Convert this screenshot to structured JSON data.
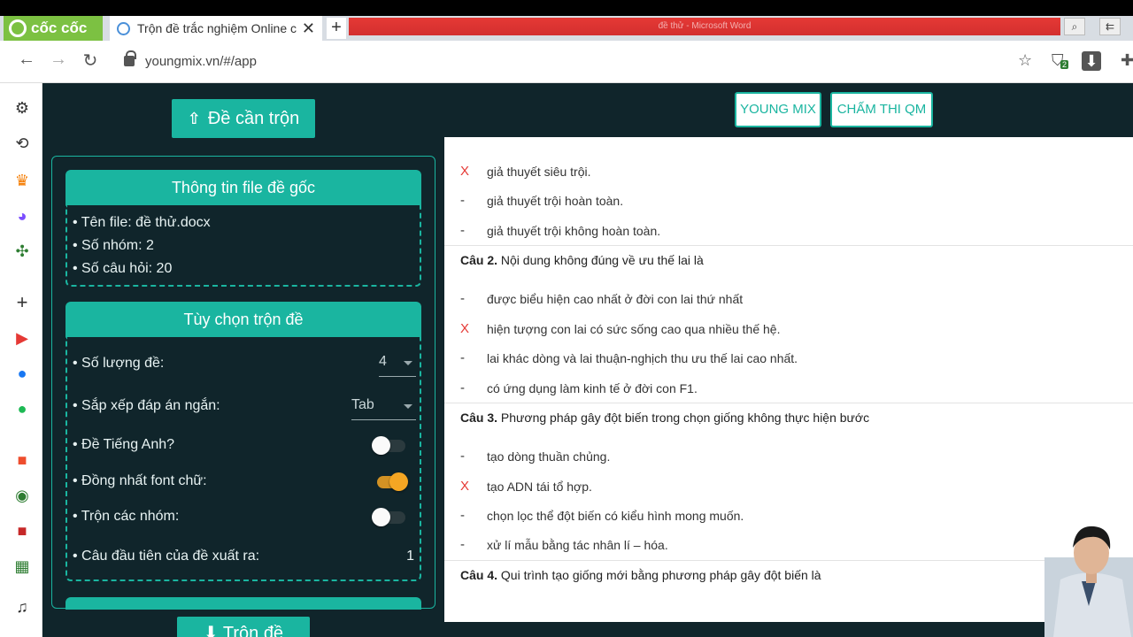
{
  "browser": {
    "brand": "cốc cốc",
    "tab_title": "Trộn đề trắc nghiệm Online c",
    "tab_close": "✕",
    "new_tab": "+",
    "red_strip_text": "đề thử - Microsoft Word",
    "url": "youngmix.vn/#/app",
    "extension_badge": "2"
  },
  "app": {
    "upload_button": "Đề cần trộn",
    "file_info": {
      "title": "Thông tin file đề gốc",
      "lines": [
        "• Tên file: đề thử.docx",
        "• Số nhóm: 2",
        "• Số câu hỏi: 20"
      ]
    },
    "options": {
      "title": "Tùy chọn trộn đề",
      "count_label": "• Số lượng đề:",
      "count_value": "4",
      "sort_label": "• Sắp xếp đáp án ngắn:",
      "sort_value": "Tab",
      "english_label": "• Đề Tiếng Anh?",
      "english_on": false,
      "font_label": "• Đồng nhất font chữ:",
      "font_on": true,
      "groups_label": "• Trộn các nhóm:",
      "groups_on": false,
      "first_q_label": "• Câu đầu tiên của đề xuất ra:",
      "first_q_value": "1"
    },
    "mix_button": "Trộn đề",
    "top_buttons": [
      "YOUNG MIX",
      "CHẤM THI QM"
    ],
    "colors": {
      "teal": "#1ab5a0",
      "bg": "#10252b",
      "orange": "#f5a623",
      "mark_red": "#e53935"
    }
  },
  "document": {
    "q1_answers": [
      {
        "mark": "X",
        "text": "giả thuyết siêu trội."
      },
      {
        "mark": "-",
        "text": "giả thuyết trội hoàn toàn."
      },
      {
        "mark": "-",
        "text": "giả thuyết trội không hoàn toàn."
      }
    ],
    "q2": {
      "num": "Câu 2.",
      "text": "Nội dung không đúng về ưu thế lai là"
    },
    "q2_answers": [
      {
        "mark": "-",
        "text": "được biểu hiện cao nhất ở đời con lai thứ nhất"
      },
      {
        "mark": "X",
        "text": "hiện tượng con lai có sức sống cao qua nhiều thế hệ."
      },
      {
        "mark": "-",
        "text": "lai khác dòng và lai thuận-nghịch thu ưu thế lai cao nhất."
      },
      {
        "mark": "-",
        "text": "có ứng dụng làm kinh tế ở đời con F1."
      }
    ],
    "q3": {
      "num": "Câu 3.",
      "text": "Phương pháp gây đột biến trong chọn giống không thực hiện bước"
    },
    "q3_answers": [
      {
        "mark": "-",
        "text": "tạo dòng thuần chủng."
      },
      {
        "mark": "X",
        "text": "tạo ADN tái tổ hợp."
      },
      {
        "mark": "-",
        "text": "chọn lọc thể đột biến có kiểu hình mong muốn."
      },
      {
        "mark": "-",
        "text": "xử lí mẫu bằng tác nhân lí – hóa."
      }
    ],
    "q4": {
      "num": "Câu 4.",
      "text": "Qui trình tạo giống mới bằng phương pháp gây đột biến là"
    }
  }
}
